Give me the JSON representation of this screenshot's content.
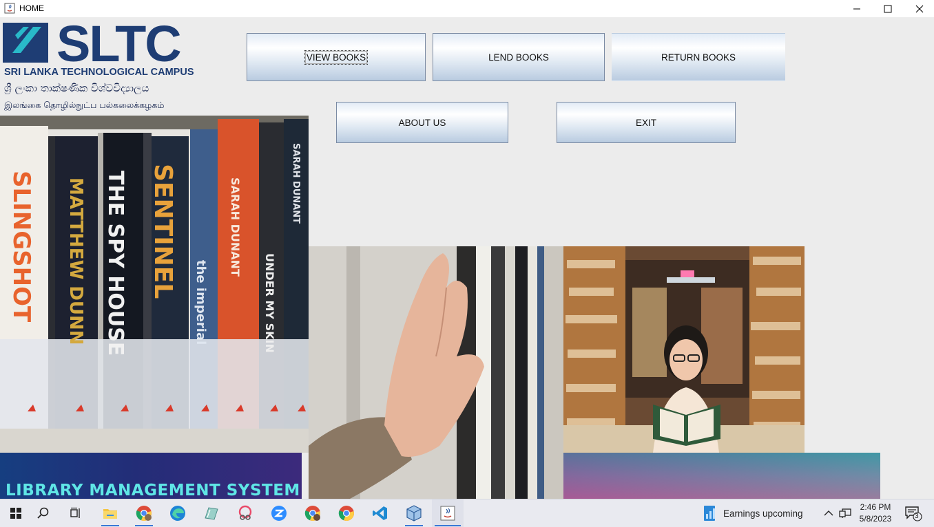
{
  "window": {
    "title": "HOME"
  },
  "logo": {
    "brand": "SLTC",
    "subtitle": "SRI LANKA TECHNOLOGICAL CAMPUS",
    "sinhala": "ශ්‍රී ලංකා තාක්ෂණික විශ්වවිද්‍යාලය",
    "tamil": "இலங்கை தொழில்நுட்ப பல்கலைக்கழகம்"
  },
  "buttons": {
    "view_books": "VIEW BOOKS",
    "lend_books": "LEND BOOKS",
    "return_books": "RETURN BOOKS",
    "about_us": "ABOUT US",
    "exit": "EXIT"
  },
  "banner": {
    "text": "LIBRARY MANAGEMENT SYSTEM"
  },
  "book_spines": [
    "SLINGSHOT",
    "MATTHEW DUNN",
    "THE SPY HOUSE",
    "SENTINEL",
    "the imperial",
    "SARAH DUNANT",
    "UNDER MY SKIN",
    "SARAH DUNANT"
  ],
  "taskbar": {
    "news": "Earnings upcoming",
    "time": "2:46 PM",
    "date": "5/8/2023",
    "notifications": "3"
  },
  "colors": {
    "brand_blue": "#1e3d74",
    "accent_cyan": "#29b9c9",
    "banner_text": "#5fe6e6",
    "taskbar_accent": "#3b78d6"
  }
}
